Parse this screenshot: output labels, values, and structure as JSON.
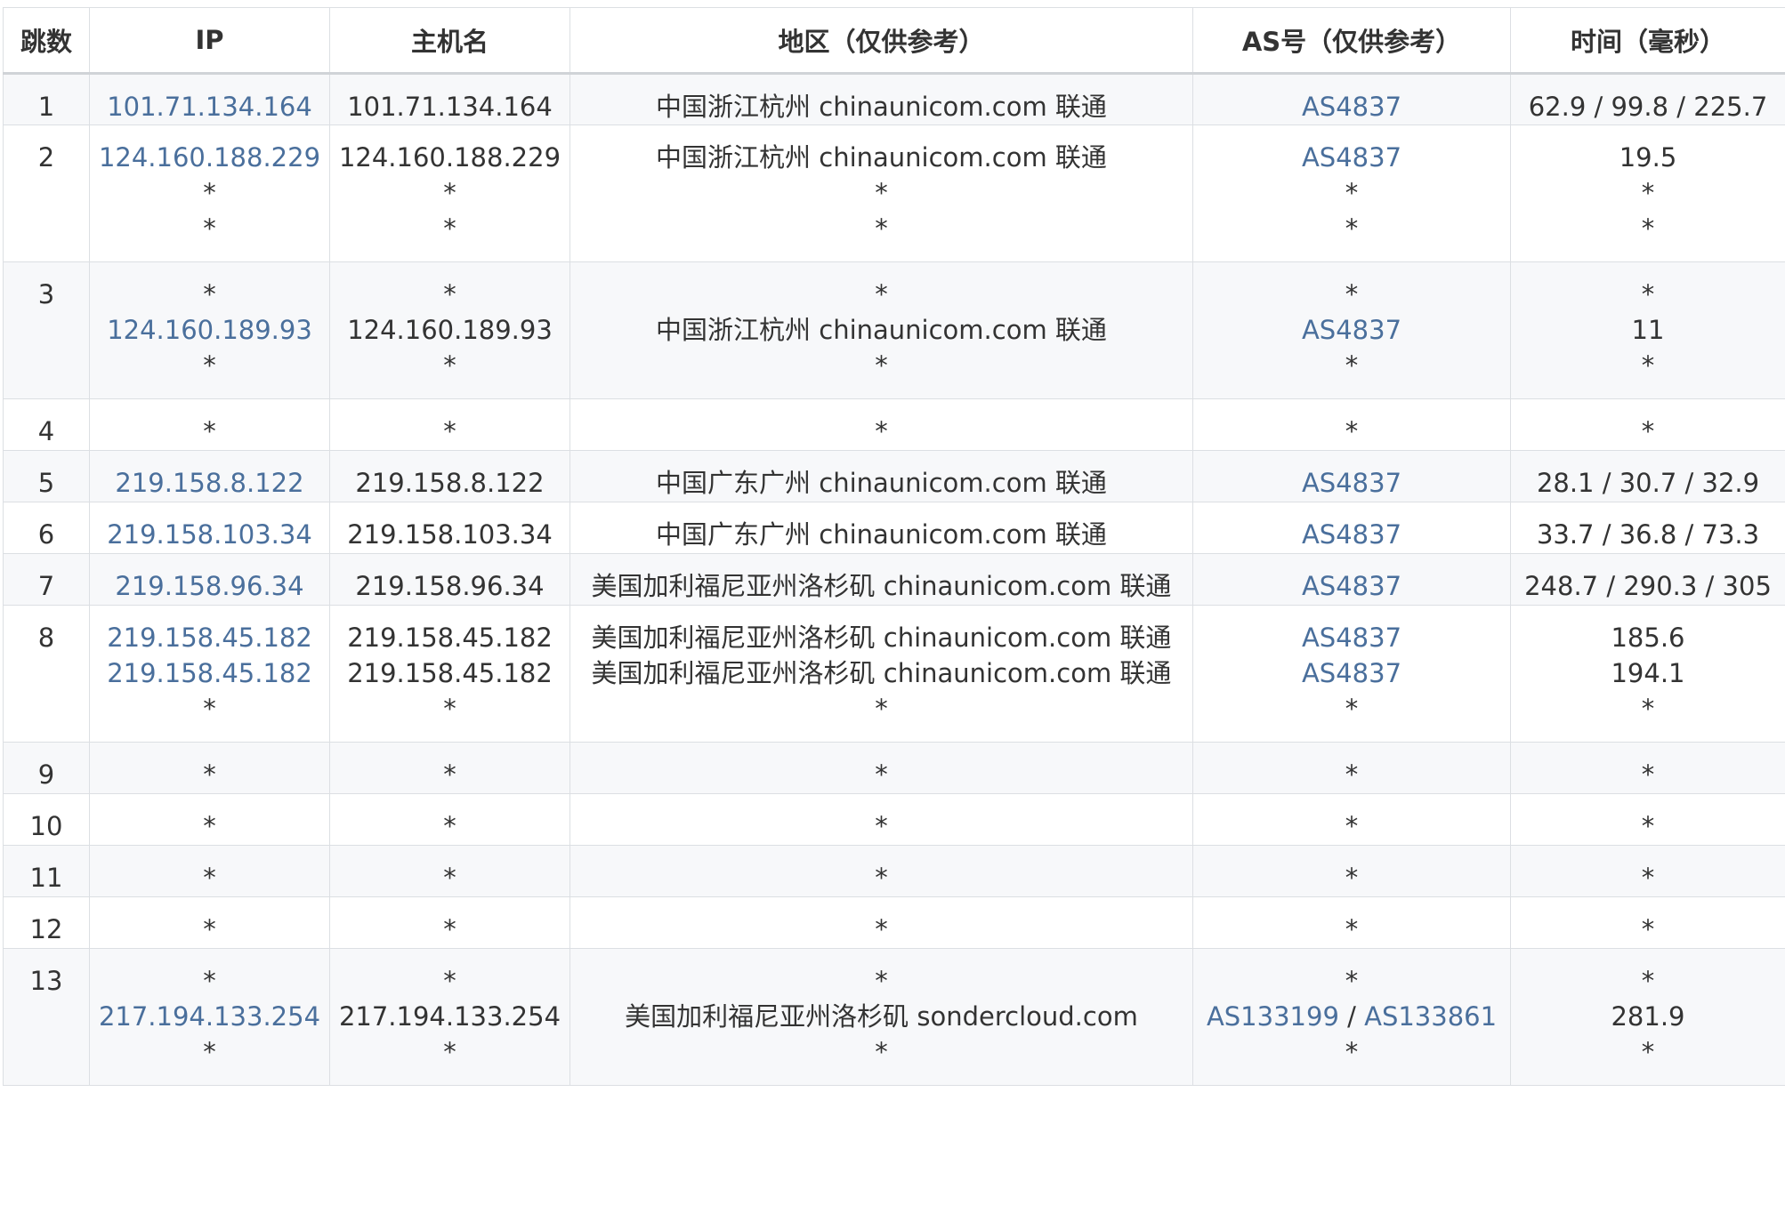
{
  "headers": {
    "hop": "跳数",
    "ip": "IP",
    "hostname": "主机名",
    "region": "地区（仅供参考）",
    "asn": "AS号（仅供参考）",
    "time": "时间（毫秒）"
  },
  "colors": {
    "link": "#4a6f9c",
    "text": "#333333",
    "border": "#dcdfe3",
    "stripe": "#f7f8fa"
  },
  "rows": [
    {
      "hop": "1",
      "ip": [
        "101.71.134.164"
      ],
      "host": [
        "101.71.134.164"
      ],
      "region": [
        "中国浙江杭州 chinaunicom.com 联通"
      ],
      "asn": [
        "AS4837"
      ],
      "time": [
        "62.9 / 99.8 / 225.7"
      ]
    },
    {
      "hop": "2",
      "ip": [
        "124.160.188.229",
        "*",
        "*"
      ],
      "host": [
        "124.160.188.229",
        "*",
        "*"
      ],
      "region": [
        "中国浙江杭州 chinaunicom.com 联通",
        "*",
        "*"
      ],
      "asn": [
        "AS4837",
        "*",
        "*"
      ],
      "time": [
        "19.5",
        "*",
        "*"
      ]
    },
    {
      "hop": "3",
      "ip": [
        "*",
        "124.160.189.93",
        "*"
      ],
      "host": [
        "*",
        "124.160.189.93",
        "*"
      ],
      "region": [
        "*",
        "中国浙江杭州 chinaunicom.com 联通",
        "*"
      ],
      "asn": [
        "*",
        "AS4837",
        "*"
      ],
      "time": [
        "*",
        "11",
        "*"
      ]
    },
    {
      "hop": "4",
      "ip": [
        "*"
      ],
      "host": [
        "*"
      ],
      "region": [
        "*"
      ],
      "asn": [
        "*"
      ],
      "time": [
        "*"
      ]
    },
    {
      "hop": "5",
      "ip": [
        "219.158.8.122"
      ],
      "host": [
        "219.158.8.122"
      ],
      "region": [
        "中国广东广州 chinaunicom.com 联通"
      ],
      "asn": [
        "AS4837"
      ],
      "time": [
        "28.1 / 30.7 / 32.9"
      ]
    },
    {
      "hop": "6",
      "ip": [
        "219.158.103.34"
      ],
      "host": [
        "219.158.103.34"
      ],
      "region": [
        "中国广东广州 chinaunicom.com 联通"
      ],
      "asn": [
        "AS4837"
      ],
      "time": [
        "33.7 / 36.8 / 73.3"
      ]
    },
    {
      "hop": "7",
      "ip": [
        "219.158.96.34"
      ],
      "host": [
        "219.158.96.34"
      ],
      "region": [
        "美国加利福尼亚州洛杉矶 chinaunicom.com 联通"
      ],
      "asn": [
        "AS4837"
      ],
      "time": [
        "248.7 / 290.3 / 305"
      ]
    },
    {
      "hop": "8",
      "ip": [
        "219.158.45.182",
        "219.158.45.182",
        "*"
      ],
      "host": [
        "219.158.45.182",
        "219.158.45.182",
        "*"
      ],
      "region": [
        "美国加利福尼亚州洛杉矶 chinaunicom.com 联通",
        "美国加利福尼亚州洛杉矶 chinaunicom.com 联通",
        "*"
      ],
      "asn": [
        "AS4837",
        "AS4837",
        "*"
      ],
      "time": [
        "185.6",
        "194.1",
        "*"
      ]
    },
    {
      "hop": "9",
      "ip": [
        "*"
      ],
      "host": [
        "*"
      ],
      "region": [
        "*"
      ],
      "asn": [
        "*"
      ],
      "time": [
        "*"
      ]
    },
    {
      "hop": "10",
      "ip": [
        "*"
      ],
      "host": [
        "*"
      ],
      "region": [
        "*"
      ],
      "asn": [
        "*"
      ],
      "time": [
        "*"
      ]
    },
    {
      "hop": "11",
      "ip": [
        "*"
      ],
      "host": [
        "*"
      ],
      "region": [
        "*"
      ],
      "asn": [
        "*"
      ],
      "time": [
        "*"
      ]
    },
    {
      "hop": "12",
      "ip": [
        "*"
      ],
      "host": [
        "*"
      ],
      "region": [
        "*"
      ],
      "asn": [
        "*"
      ],
      "time": [
        "*"
      ]
    },
    {
      "hop": "13",
      "ip": [
        "*",
        "217.194.133.254",
        "*"
      ],
      "host": [
        "*",
        "217.194.133.254",
        "*"
      ],
      "region": [
        "*",
        "美国加利福尼亚州洛杉矶 sondercloud.com",
        "*"
      ],
      "asn": [
        "*",
        [
          "AS133199",
          "AS133861"
        ],
        "*"
      ],
      "time": [
        "*",
        "281.9",
        "*"
      ]
    }
  ]
}
